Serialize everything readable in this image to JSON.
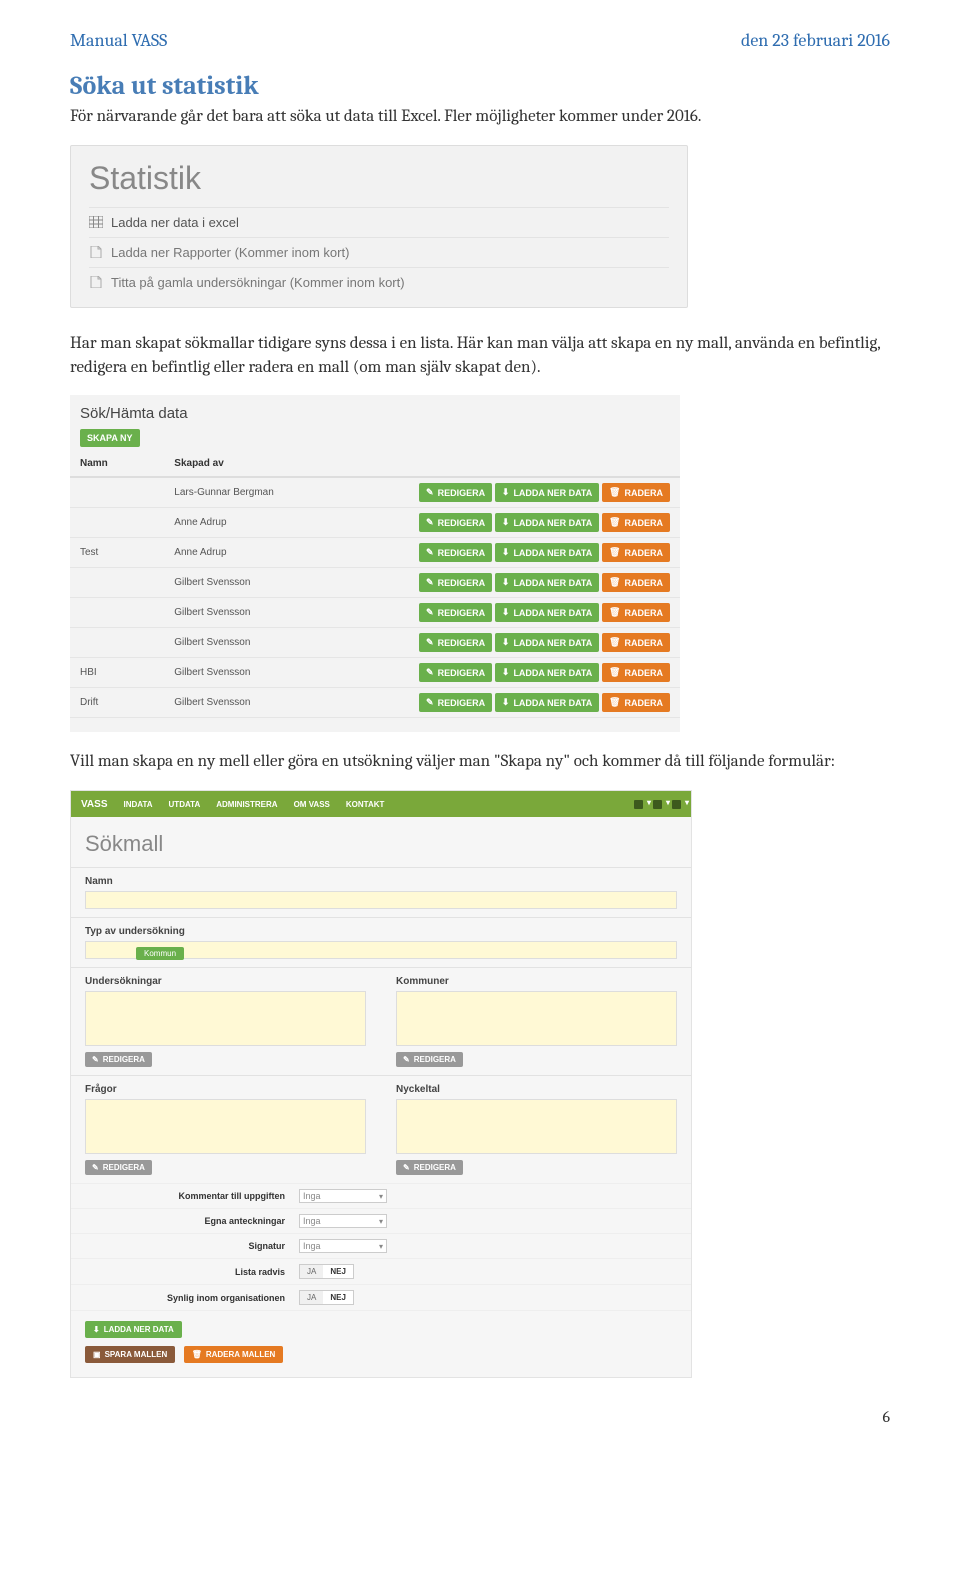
{
  "header": {
    "left": "Manual VASS",
    "right": "den 23 februari 2016"
  },
  "section_title": "Söka ut statistik",
  "intro_text": "För närvarande går det bara att söka ut data till Excel. Fler möjligheter kommer under 2016.",
  "panel": {
    "title": "Statistik",
    "items": [
      {
        "label": "Ladda ner data i excel",
        "icon": "grid"
      },
      {
        "label": "Ladda ner Rapporter (Kommer inom kort)",
        "icon": "doc"
      },
      {
        "label": "Titta på gamla undersökningar (Kommer inom kort)",
        "icon": "doc"
      }
    ]
  },
  "mid_text": "Har man skapat sökmallar tidigare syns dessa i en lista. Här kan man välja att skapa en ny mall, använda en befintlig, redigera en befintlig eller radera en mall (om man själv skapat den).",
  "table": {
    "title": "Sök/Hämta data",
    "create_button": "SKAPA NY",
    "headers": {
      "name": "Namn",
      "created_by": "Skapad av"
    },
    "actions": {
      "edit": "REDIGERA",
      "download": "LADDA NER DATA",
      "delete": "RADERA"
    },
    "rows": [
      {
        "name": "",
        "created_by": "Lars-Gunnar Bergman"
      },
      {
        "name": "",
        "created_by": "Anne Adrup"
      },
      {
        "name": "Test",
        "created_by": "Anne Adrup"
      },
      {
        "name": "",
        "created_by": "Gilbert Svensson"
      },
      {
        "name": "",
        "created_by": "Gilbert Svensson"
      },
      {
        "name": "",
        "created_by": "Gilbert Svensson"
      },
      {
        "name": "HBI",
        "created_by": "Gilbert Svensson"
      },
      {
        "name": "Drift",
        "created_by": "Gilbert Svensson"
      }
    ]
  },
  "after_table_text": "Vill man skapa en ny mell eller göra en utsökning väljer man \"Skapa ny\" och kommer då till följande formulär:",
  "form": {
    "navbar": {
      "brand": "VASS",
      "items": [
        "INDATA",
        "UTDATA",
        "ADMINISTRERA",
        "OM VASS",
        "KONTAKT"
      ]
    },
    "title": "Sökmall",
    "labels": {
      "name": "Namn",
      "type": "Typ av undersökning",
      "type_tag": "Kommun",
      "undersokningar": "Undersökningar",
      "kommuner": "Kommuner",
      "fragor": "Frågor",
      "nyckeltal": "Nyckeltal",
      "edit": "REDIGERA"
    },
    "settings": [
      {
        "label": "Kommentar till uppgiften",
        "control": "dropdown",
        "value": "Inga"
      },
      {
        "label": "Egna anteckningar",
        "control": "dropdown",
        "value": "Inga"
      },
      {
        "label": "Signatur",
        "control": "dropdown",
        "value": "Inga"
      },
      {
        "label": "Lista radvis",
        "control": "toggle",
        "value": "NEJ",
        "options": [
          "JA",
          "NEJ"
        ]
      },
      {
        "label": "Synlig inom organisationen",
        "control": "toggle",
        "value": "NEJ",
        "options": [
          "JA",
          "NEJ"
        ]
      }
    ],
    "bottom_buttons": {
      "download": "LADDA NER DATA",
      "save": "SPARA MALLEN",
      "delete": "RADERA MALLEN"
    }
  },
  "page_number": "6"
}
